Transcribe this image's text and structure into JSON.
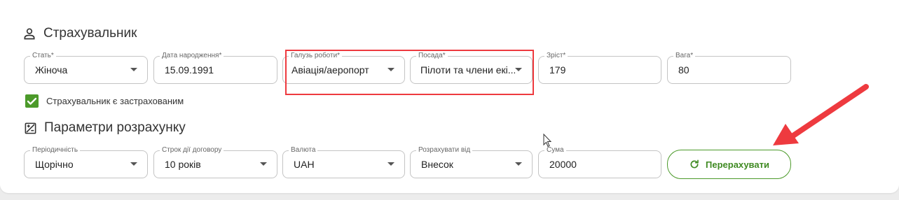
{
  "insured": {
    "title": "Страхувальник",
    "fields": {
      "gender": {
        "label": "Стать*",
        "value": "Жіноча"
      },
      "birthdate": {
        "label": "Дата народження*",
        "value": "15.09.1991"
      },
      "industry": {
        "label": "Галузь роботи*",
        "value": "Авіація/аеропорт"
      },
      "position": {
        "label": "Посада*",
        "value": "Пілоти та члени екі..."
      },
      "height": {
        "label": "Зріст*",
        "value": "179"
      },
      "weight": {
        "label": "Вага*",
        "value": "80"
      }
    },
    "checkbox_label": "Страхувальник є застрахованим",
    "checkbox_checked": true
  },
  "calc": {
    "title": "Параметри розрахунку",
    "fields": {
      "periodicity": {
        "label": "Періодичність",
        "value": "Щорічно"
      },
      "term": {
        "label": "Строк дії договору",
        "value": "10 років"
      },
      "currency": {
        "label": "Валюта",
        "value": "UAH"
      },
      "calc_from": {
        "label": "Розрахувати від",
        "value": "Внесок"
      },
      "sum": {
        "label": "Сума",
        "value": "20000"
      }
    },
    "recalc_label": "Перерахувати"
  },
  "colors": {
    "accent": "#4c9a2a",
    "annotation": "#ee3a3f"
  },
  "icons": [
    "person-icon",
    "calculator-icon",
    "check-icon",
    "refresh-icon",
    "chevron-down-icon",
    "mouse-cursor-icon",
    "annotation-arrow"
  ]
}
